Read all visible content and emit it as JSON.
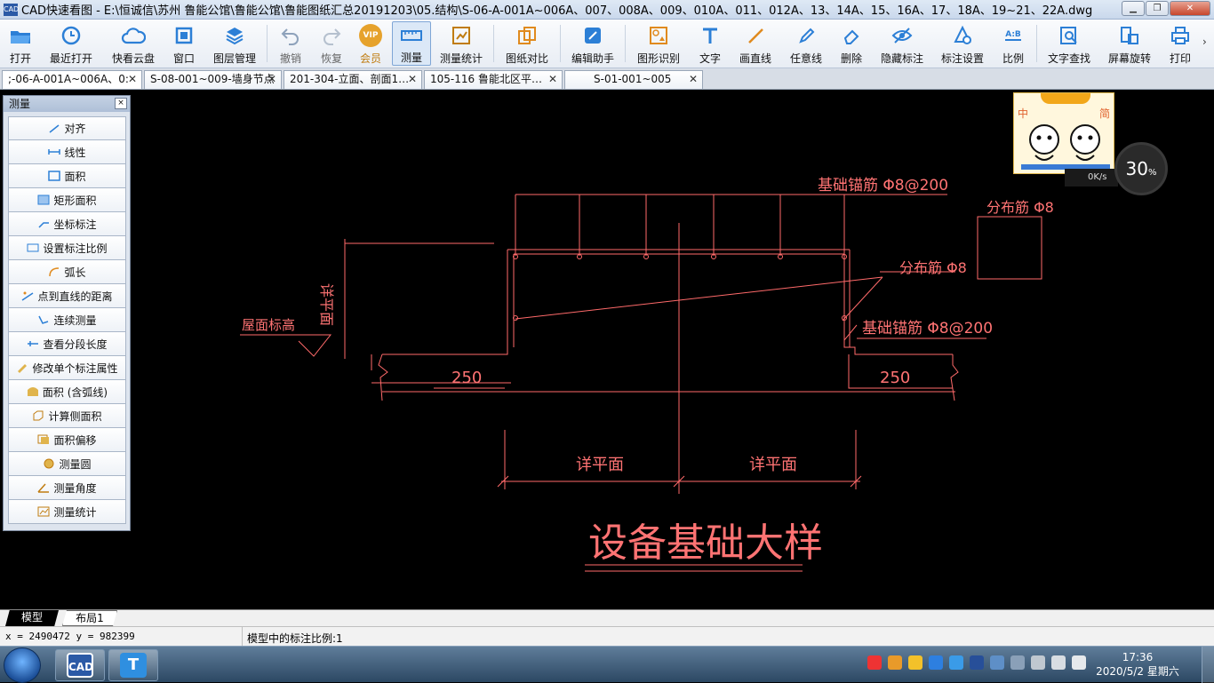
{
  "window": {
    "app_icon_text": "CAD",
    "title": "CAD快速看图 - E:\\恒诚信\\苏州 鲁能公馆\\鲁能公馆\\鲁能图纸汇总20191203\\05.结构\\S-06-A-001A~006A、007、008A、009、010A、011、012A、13、14A、15、16A、17、18A、19~21、22A.dwg",
    "min_symbol": "▁",
    "max_symbol": "❐",
    "close_symbol": "✕"
  },
  "toolbar": {
    "open": "打开",
    "recent": "最近打开",
    "cloud": "快看云盘",
    "window": "窗口",
    "layers": "图层管理",
    "undo": "撤销",
    "redo": "恢复",
    "vip": "会员",
    "vip_badge": "VIP",
    "measure": "测量",
    "measure_stats": "测量统计",
    "compare": "图纸对比",
    "edit_helper": "编辑助手",
    "shape_recog": "图形识别",
    "text": "文字",
    "line": "画直线",
    "freeline": "任意线",
    "erase": "删除",
    "hide_dim": "隐藏标注",
    "dim_settings": "标注设置",
    "scale": "比例",
    "scale_icon_text": "A:B",
    "find_text": "文字查找",
    "rotate": "屏幕旋转",
    "print": "打印",
    "more": "›"
  },
  "tabs": [
    {
      "label": ";-06-A-001A~006A、0:",
      "close": "✕"
    },
    {
      "label": "S-08-001~009-墙身节点",
      "close": "✕"
    },
    {
      "label": "201-304-立面、剖面1…",
      "close": "✕"
    },
    {
      "label": "105-116 鲁能北区平…",
      "close": "✕"
    },
    {
      "label": "S-01-001~005",
      "close": "✕"
    }
  ],
  "measure_panel": {
    "title": "测量",
    "close": "×",
    "items": [
      {
        "label": "对齐",
        "icon": "aligned-dim-icon"
      },
      {
        "label": "线性",
        "icon": "linear-dim-icon"
      },
      {
        "label": "面积",
        "icon": "area-icon"
      },
      {
        "label": "矩形面积",
        "icon": "rect-area-icon"
      },
      {
        "label": "坐标标注",
        "icon": "coordinate-icon"
      },
      {
        "label": "设置标注比例",
        "icon": "scale-setting-icon"
      },
      {
        "label": "弧长",
        "icon": "arc-length-icon"
      },
      {
        "label": "点到直线的距离",
        "icon": "point-line-distance-icon"
      },
      {
        "label": "连续测量",
        "icon": "continuous-measure-icon"
      },
      {
        "label": "查看分段长度",
        "icon": "segment-length-icon"
      },
      {
        "label": "修改单个标注属性",
        "icon": "edit-dim-icon"
      },
      {
        "label": "面积 (含弧线)",
        "icon": "arc-area-icon"
      },
      {
        "label": "计算侧面积",
        "icon": "side-area-icon"
      },
      {
        "label": "面积偏移",
        "icon": "area-offset-icon"
      },
      {
        "label": "测量圆",
        "icon": "circle-measure-icon"
      },
      {
        "label": "测量角度",
        "icon": "angle-measure-icon"
      },
      {
        "label": "测量统计",
        "icon": "measure-stats-icon"
      }
    ]
  },
  "drawing": {
    "label_anchor_top": "基础锚筋 Φ8@200",
    "label_dist_right": "分布筋 Φ8",
    "label_dist_mid": "分布筋 Φ8",
    "label_anchor_bottom": "基础锚筋 Φ8@200",
    "label_roof": "屋面标高",
    "label_vertical": "详平面",
    "dim_left": "250",
    "dim_right": "250",
    "dim_plan_left": "详平面",
    "dim_plan_right": "详平面",
    "title": "设备基础大样",
    "line_color": "#ff6a6a",
    "text_color": "#ff7373"
  },
  "float_widget": {
    "left_char": "中",
    "right_char": "简",
    "speed": "0K/s",
    "percent": "30",
    "percent_unit": "%"
  },
  "layout_tabs": {
    "model": "模型",
    "layout1": "布局1"
  },
  "status": {
    "coords": "x = 2490472  y = 982399",
    "scale_text": "模型中的标注比例:1"
  },
  "taskbar": {
    "cad_label": "CAD",
    "t_label": "T",
    "time": "17:36",
    "date": "2020/5/2 星期六"
  }
}
